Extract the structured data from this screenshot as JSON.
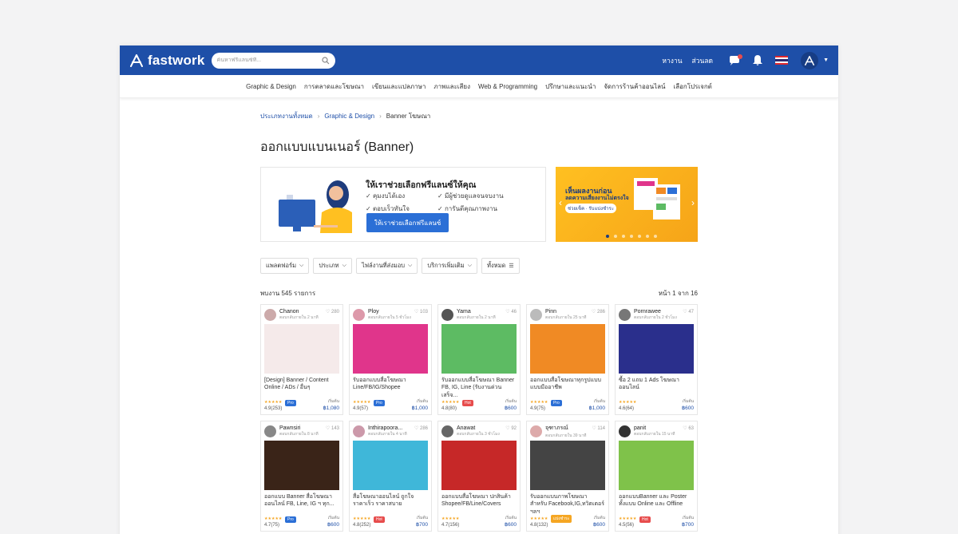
{
  "header": {
    "logo_text": "fastwork",
    "search_placeholder": "ค้นหาฟรีแลนซ์ที่...",
    "links": [
      "หางาน",
      "ส่วนลด"
    ],
    "icons": [
      "chat-icon",
      "bell-icon",
      "thai-flag-icon",
      "profile-avatar-icon"
    ],
    "brand_color": "#1e4fa8"
  },
  "categories": [
    "Graphic & Design",
    "การตลาดและโฆษณา",
    "เขียนและแปลภาษา",
    "ภาพและเสียง",
    "Web & Programming",
    "ปรึกษาและแนะนำ",
    "จัดการร้านค้าออนไลน์",
    "เลือกโปรเจกต์"
  ],
  "breadcrumb": [
    "ประเภทงานทั้งหมด",
    "Graphic & Design",
    "Banner โฆษณา"
  ],
  "page_title": "ออกแบบแบนเนอร์ (Banner)",
  "helpbox": {
    "title": "ให้เราช่วยเลือกฟรีแลนซ์ให้คุณ",
    "checks": [
      "คุมงบได้เอง",
      "มีผู้ช่วยดูแลจนจบงาน",
      "ตอบเร็วทันใจ",
      "การันตีคุณภาพงาน"
    ],
    "button": "ให้เราช่วยเลือกฟรีแลนซ์"
  },
  "promo": {
    "line1": "เห็นผลงานก่อน",
    "line2": "ลดความเสี่ยงงานไม่ตรงใจ",
    "line3": "ช่วยเช็ค · รับแบ่งชำระ"
  },
  "filters": [
    "แพลตฟอร์ม",
    "ประเภท",
    "ไฟล์งานที่ส่งมอบ",
    "บริการเพิ่มเติม",
    "ทั้งหมด"
  ],
  "result_count": "พบงาน 545 รายการ",
  "pagination": "หน้า 1 จาก 16",
  "cards": [
    {
      "user": "Chanon",
      "sub": "ตอบกลับภายใน 2 นาที",
      "likes": "280",
      "title": "[Design] Banner / Content Online / ADs / อื่นๆ",
      "rating": "4.9(253)",
      "badge": "Pro",
      "badge_color": "#2b6fd6",
      "from": "เริ่มต้น",
      "price": "฿1,080",
      "thumb": "#f5eaea",
      "avatar": "#caa"
    },
    {
      "user": "Ploy",
      "sub": "ตอบกลับภายใน 5 ชั่วโมง",
      "likes": "103",
      "title": "รับออกแบบสื่อโฆษณา Line/FB/IG/Shopee",
      "rating": "4.9(57)",
      "badge": "Pro",
      "badge_color": "#2b6fd6",
      "from": "เริ่มต้น",
      "price": "฿1,000",
      "thumb": "#e0358b",
      "avatar": "#d9a"
    },
    {
      "user": "Yama",
      "sub": "ตอบกลับภายใน 2 นาที",
      "likes": "46",
      "title": "รับออกแบบสื่อโฆษณา Banner FB, IG, Line (รับงานด่วนเสร็จ...",
      "rating": "4.8(80)",
      "badge": "Hot",
      "badge_color": "#e74c4c",
      "from": "เริ่มต้น",
      "price": "฿600",
      "thumb": "#5dbb63",
      "avatar": "#555"
    },
    {
      "user": "Pinn",
      "sub": "ตอบกลับภายใน 25 นาที",
      "likes": "286",
      "title": "ออกแบบสื่อโฆษณาทุกรูปแบบ แบบมืออาชีพ",
      "rating": "4.9(75)",
      "badge": "Pro",
      "badge_color": "#2b6fd6",
      "from": "เริ่มต้น",
      "price": "฿1,000",
      "thumb": "#f08a24",
      "avatar": "#bbb"
    },
    {
      "user": "Pornrawee",
      "sub": "ตอบกลับภายใน 2 ชั่วโมง",
      "likes": "47",
      "title": "ซื้อ 2 แถม 1 Ads โฆษณาออนไลน์",
      "rating": "4.6(64)",
      "badge": "",
      "badge_color": "",
      "from": "เริ่มต้น",
      "price": "฿600",
      "thumb": "#2a2f8c",
      "avatar": "#777"
    },
    {
      "user": "Pawnsiri",
      "sub": "ตอบกลับภายใน 8 นาที",
      "likes": "143",
      "title": "ออกแบบ Banner สื่อโฆษณาออนไลน์ FB, Line, IG ฯ ทุก...",
      "rating": "4.7(75)",
      "badge": "Pro",
      "badge_color": "#2b6fd6",
      "from": "เริ่มต้น",
      "price": "฿600",
      "thumb": "#3a2418",
      "avatar": "#888"
    },
    {
      "user": "Inthirapoora...",
      "sub": "ตอบกลับภายใน 4 นาที",
      "likes": "286",
      "title": "สื่อโฆษณาออนไลน์ ถูกใจ ราคาเร็ว ราคาสบาย",
      "rating": "4.8(252)",
      "badge": "Hot",
      "badge_color": "#e74c4c",
      "from": "เริ่มต้น",
      "price": "฿700",
      "thumb": "#3fb7d9",
      "avatar": "#c9a"
    },
    {
      "user": "Anawat",
      "sub": "ตอบกลับภายใน 3 ชั่วโมง",
      "likes": "92",
      "title": "ออกแบบสื่อโฆษณา ปกสินค้า Shopee/FB/Line/Covers",
      "rating": "4.7(156)",
      "badge": "",
      "badge_color": "",
      "from": "เริ่มต้น",
      "price": "฿600",
      "thumb": "#c62828",
      "avatar": "#666"
    },
    {
      "user": "จุฑาภรณ์",
      "sub": "ตอบกลับภายใน 39 นาที",
      "likes": "114",
      "title": "รับออกแบบภาพโฆษณา สำหรับ Facebook,IG,ทวิตเตอร์ ฯลฯ",
      "rating": "4.8(132)",
      "badge": "แบ่งชำระ",
      "badge_color": "#f5a623",
      "from": "เริ่มต้น",
      "price": "฿600",
      "thumb": "#444",
      "avatar": "#daa"
    },
    {
      "user": "panit",
      "sub": "ตอบกลับภายใน 15 นาที",
      "likes": "63",
      "title": "ออกแบบBanner และ Poster ทั้งแบบ Online และ Offline",
      "rating": "4.5(56)",
      "badge": "Hot",
      "badge_color": "#e74c4c",
      "from": "เริ่มต้น",
      "price": "฿700",
      "thumb": "#7fc24a",
      "avatar": "#333"
    }
  ]
}
